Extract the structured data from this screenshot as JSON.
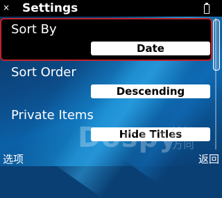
{
  "header": {
    "title": "Settings",
    "close_icon": "×"
  },
  "items": [
    {
      "label": "Sort By",
      "value": "Date"
    },
    {
      "label": "Sort Order",
      "value": "Descending"
    },
    {
      "label": "Private Items",
      "value": "Hide Titles"
    }
  ],
  "softkeys": {
    "left": "选项",
    "right": "返回"
  },
  "watermark": {
    "text": "Dospy",
    "sub": "论坛方向"
  },
  "colors": {
    "titlebar_bg": "#000000",
    "selection_border": "#c0232d",
    "value_box_bg": "#ffffff"
  }
}
